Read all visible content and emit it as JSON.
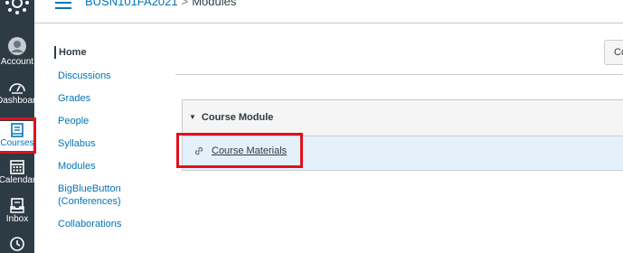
{
  "global_nav": {
    "items": [
      {
        "label": "Account",
        "icon": "account-icon"
      },
      {
        "label": "Dashboard",
        "icon": "dashboard-icon"
      },
      {
        "label": "Courses",
        "icon": "courses-icon",
        "active": true
      },
      {
        "label": "Calendar",
        "icon": "calendar-icon"
      },
      {
        "label": "Inbox",
        "icon": "inbox-icon"
      },
      {
        "label": "",
        "icon": "history-icon"
      }
    ]
  },
  "header": {
    "course": "BUSN101FA2021",
    "separator": ">",
    "page": "Modules"
  },
  "course_nav": {
    "items": [
      "Home",
      "Discussions",
      "Grades",
      "People",
      "Syllabus",
      "Modules",
      "BigBlueButton (Conferences)",
      "Collaborations"
    ]
  },
  "toolbar": {
    "button_label": "Co"
  },
  "module": {
    "caret": "▼",
    "title": "Course Module",
    "items": [
      {
        "title": "Course Materials",
        "icon": "link-icon"
      }
    ]
  },
  "colors": {
    "nav_bg": "#2d3b45",
    "link": "#0374b5",
    "highlight": "#e0111b",
    "item_bg": "#e4f1fa"
  }
}
